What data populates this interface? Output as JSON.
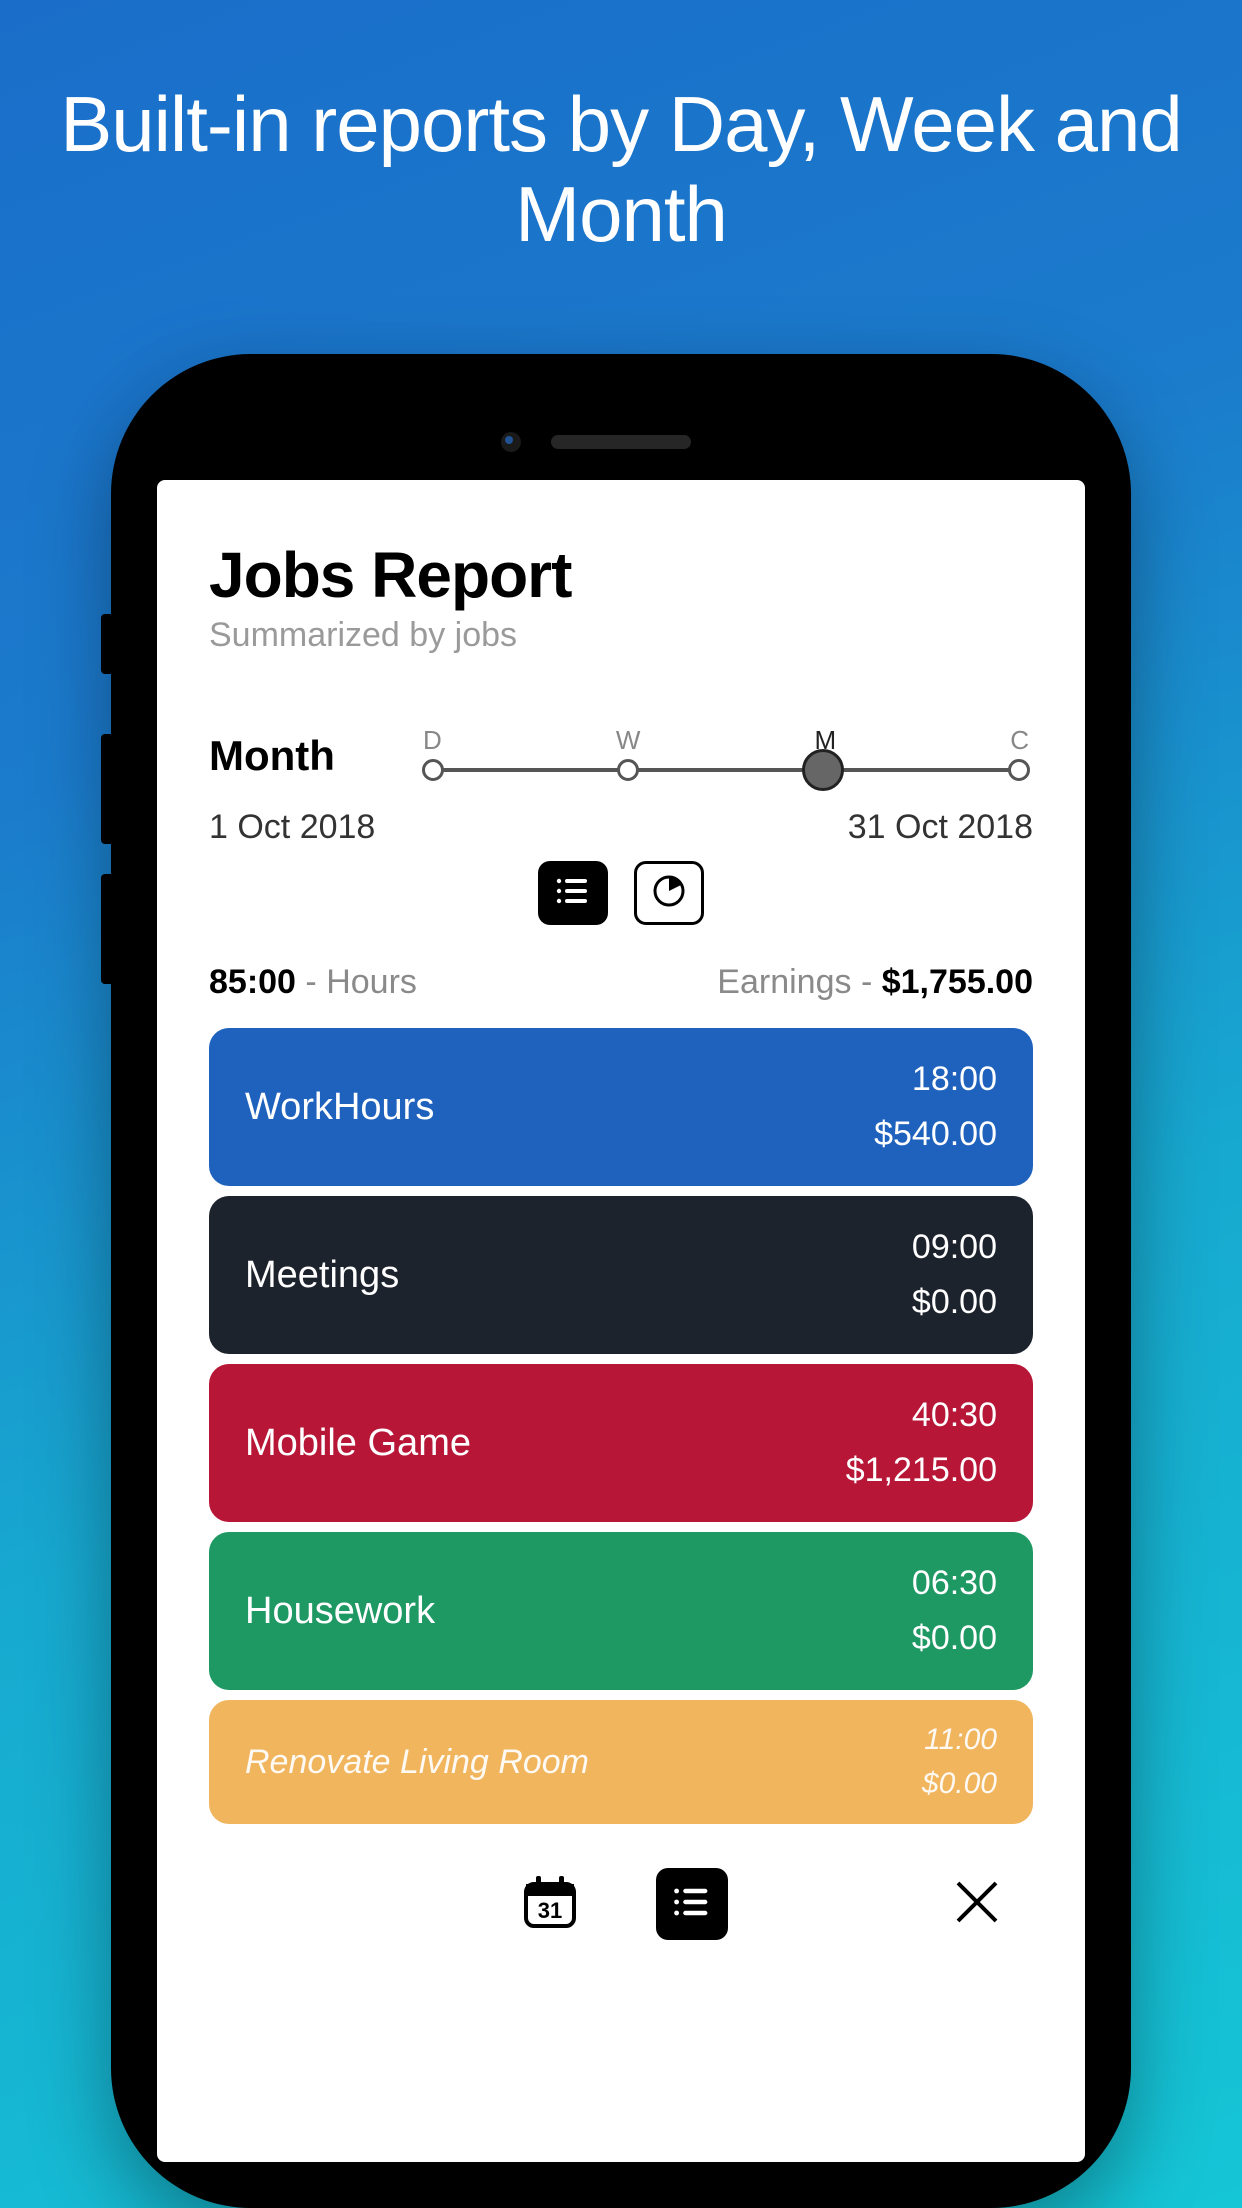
{
  "promo": {
    "headline": "Built-in reports by Day, Week and Month"
  },
  "header": {
    "title": "Jobs Report",
    "subtitle": "Summarized by jobs"
  },
  "period": {
    "label": "Month",
    "options": [
      "D",
      "W",
      "M",
      "C"
    ],
    "selected_index": 2,
    "start_date": "1 Oct 2018",
    "end_date": "31 Oct 2018"
  },
  "summary": {
    "hours_value": "85:00",
    "hours_label": "Hours",
    "earnings_label": "Earnings",
    "earnings_value": "$1,755.00"
  },
  "jobs": [
    {
      "name": "WorkHours",
      "hours": "18:00",
      "earnings": "$540.00",
      "color": "#1f62bd"
    },
    {
      "name": "Meetings",
      "hours": "09:00",
      "earnings": "$0.00",
      "color": "#1d232d"
    },
    {
      "name": "Mobile Game",
      "hours": "40:30",
      "earnings": "$1,215.00",
      "color": "#b81637"
    },
    {
      "name": "Housework",
      "hours": "06:30",
      "earnings": "$0.00",
      "color": "#1e9963"
    },
    {
      "name": "Renovate Living Room",
      "hours": "11:00",
      "earnings": "$0.00",
      "color": "#f0b55d",
      "italic": true,
      "small": true
    }
  ]
}
